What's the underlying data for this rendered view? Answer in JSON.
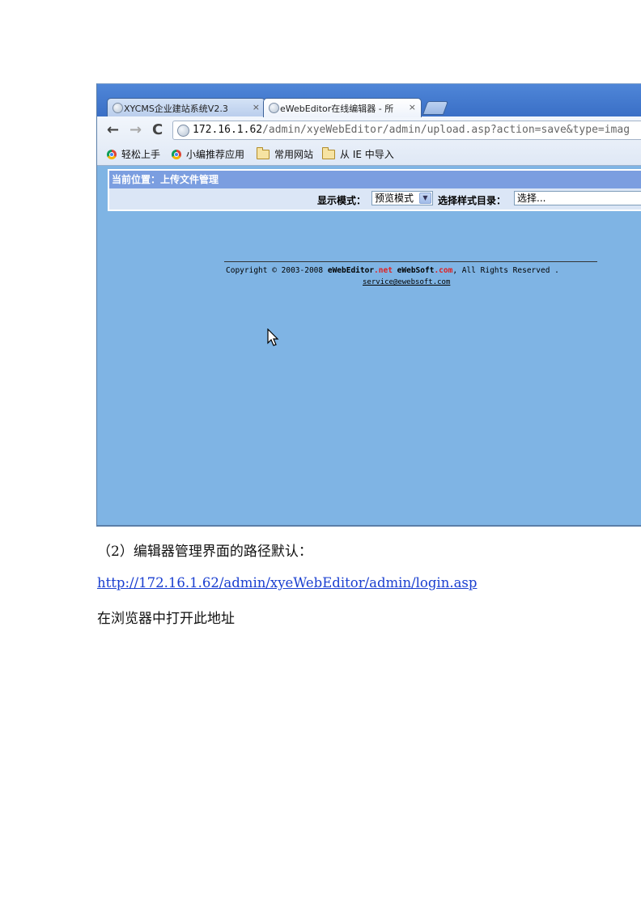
{
  "browser": {
    "tabs": [
      {
        "title": "XYCMS企业建站系统V2.3",
        "close": "×",
        "active": false
      },
      {
        "title": "eWebEditor在线编辑器 - 所",
        "close": "×",
        "active": true
      }
    ],
    "nav": {
      "back": "←",
      "forward": "→",
      "reload": "C"
    },
    "address_host": "172.16.1.62",
    "address_path": "/admin/xyeWebEditor/admin/upload.asp?action=save&type=imag",
    "bookmarks": [
      {
        "label": "轻松上手",
        "icon": "chrome-icon"
      },
      {
        "label": "小编推荐应用",
        "icon": "chrome-icon"
      },
      {
        "label": "常用网站",
        "icon": "folder-icon"
      },
      {
        "label": "从 IE 中导入",
        "icon": "folder-icon"
      }
    ]
  },
  "page": {
    "location": "当前位置：上传文件管理",
    "display_mode_label": "显示模式：",
    "display_mode_value": "预览模式",
    "style_dir_label": "选择样式目录：",
    "style_dir_value": "选择...",
    "footer": {
      "prefix": "Copyright © 2003-2008 ",
      "brand1": "eWebEditor",
      "brand1_tld": ".net",
      "brand2": "eWebSoft",
      "brand2_tld": ".com",
      "suffix": ", All Rights Reserved .",
      "email": "service@ewebsoft.com"
    },
    "background_color": "#7fb4e4"
  },
  "doc": {
    "step_heading": "（2）编辑器管理界面的路径默认：",
    "login_url": "http://172.16.1.62/admin/xyeWebEditor/admin/login.asp",
    "instruction": "在浏览器中打开此地址"
  }
}
